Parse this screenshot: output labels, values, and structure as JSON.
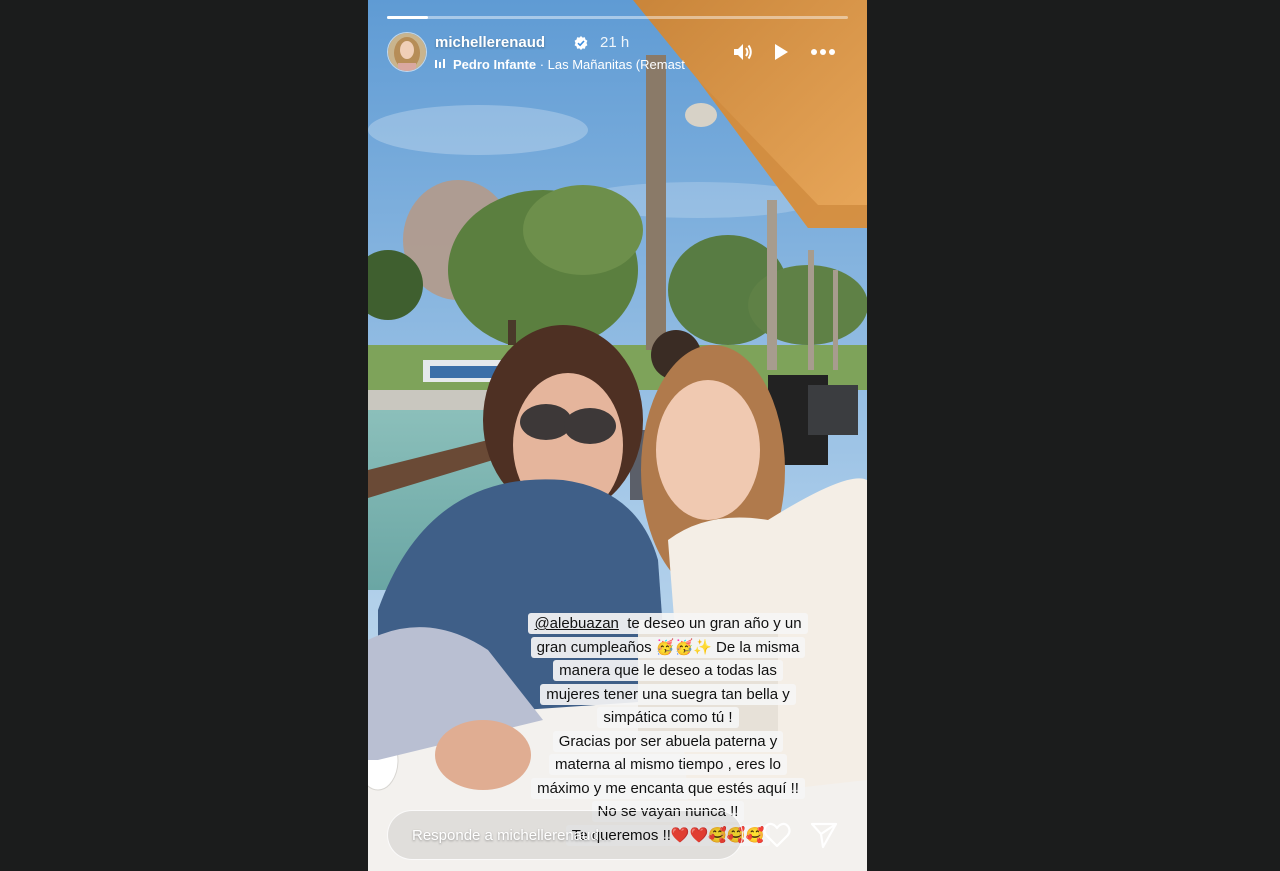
{
  "story": {
    "progress": 0.09,
    "user": {
      "username": "michellerenaud",
      "verified": true,
      "time": "21 h"
    },
    "music": {
      "bars_icon": "music-bars-icon",
      "artist": "Pedro Infante",
      "separator": " · ",
      "song": "Las Mañanitas (Remast"
    },
    "controls": {
      "volume_icon": "volume-icon",
      "play_icon": "play-icon",
      "more_icon": "more-icon"
    },
    "caption": {
      "mention": "@alebuazan",
      "lines": [
        "te deseo un gran año y un",
        "gran cumpleaños 🥳🥳✨ De la misma",
        "manera que le deseo a todas las",
        "mujeres tener una suegra tan bella y",
        "simpática como tú !",
        "Gracias por ser abuela paterna y",
        "materna al mismo tiempo , eres lo",
        "máximo y me encanta que estés aquí !!",
        "No se vayan nunca !!",
        "Te queremos !!❤️❤️🥰🥰🥰"
      ]
    },
    "reply": {
      "placeholder": "Responde a michellerenaud..."
    },
    "actions": {
      "like_icon": "heart-icon",
      "share_icon": "send-icon"
    },
    "colors": {
      "page_bg": "#1b1c1c",
      "sky": "#7fb0dc",
      "awning": "#e3a353"
    }
  }
}
